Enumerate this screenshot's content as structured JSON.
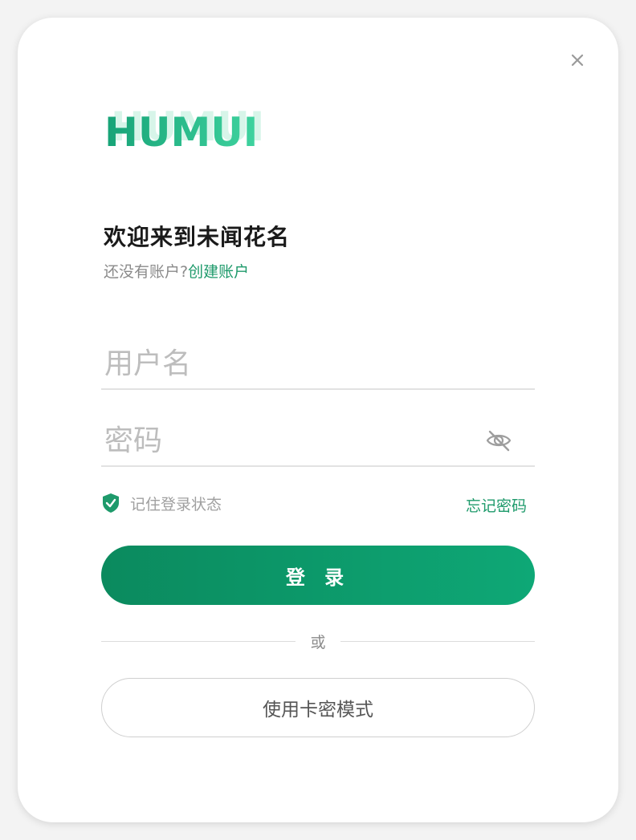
{
  "dialog": {
    "logo_text": "HUMUI",
    "title": "欢迎来到未闻花名",
    "no_account_text": "还没有账户?",
    "create_account_link": "创建账户"
  },
  "form": {
    "username_placeholder": "用户名",
    "password_placeholder": "密码",
    "remember_label": "记住登录状态",
    "remember_checked": true,
    "forgot_password_link": "忘记密码",
    "login_button": "登 录",
    "divider_text": "或",
    "card_mode_button": "使用卡密模式"
  },
  "colors": {
    "accent": "#1e9a6b",
    "button_gradient_start": "#0b8a5e",
    "button_gradient_end": "#0ea876"
  },
  "icons": {
    "close": "close-icon",
    "password_visibility": "eye-off-icon",
    "remember_check": "shield-check-icon"
  }
}
